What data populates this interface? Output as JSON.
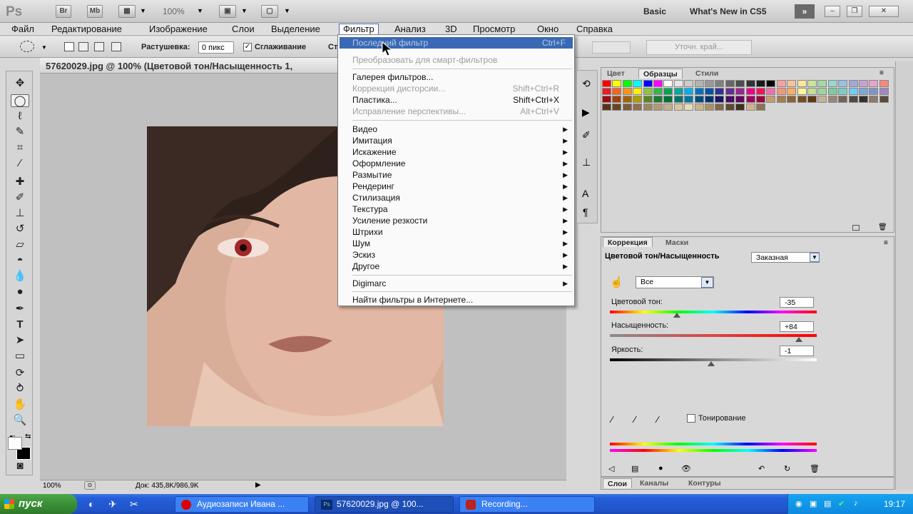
{
  "appbar": {
    "logo": "Ps",
    "bridge": "Br",
    "minibridge": "Mb",
    "zoom": "100%",
    "workspace_basic": "Basic",
    "workspace_new": "What's New in CS5"
  },
  "menubar": {
    "items": [
      "Файл",
      "Редактирование",
      "Изображение",
      "Слои",
      "Выделение",
      "Фильтр",
      "Анализ",
      "3D",
      "Просмотр",
      "Окно",
      "Справка"
    ],
    "active": "Фильтр"
  },
  "options": {
    "feather_label": "Растушевка:",
    "feather_value": "0 пикс",
    "antialias_label": "Сглаживание",
    "style_label": "Ст",
    "refine_edge": "Уточн. край..."
  },
  "document": {
    "title": "57620029.jpg @ 100% (Цветовой тон/Насыщенность 1,",
    "status_zoom": "100%",
    "status_doc": "Док: 435,8K/986,9K"
  },
  "filter_menu": {
    "last_filter": "Последний фильтр",
    "last_filter_sc": "Ctrl+F",
    "convert_smart": "Преобразовать для смарт-фильтров",
    "gallery": "Галерея фильтров...",
    "lens_correction": "Коррекция дисторсии...",
    "lens_correction_sc": "Shift+Ctrl+R",
    "liquify": "Пластика...",
    "liquify_sc": "Shift+Ctrl+X",
    "vanishing_point": "Исправление перспективы...",
    "vanishing_point_sc": "Alt+Ctrl+V",
    "submenus": [
      "Видео",
      "Имитация",
      "Искажение",
      "Оформление",
      "Размытие",
      "Рендеринг",
      "Стилизация",
      "Текстура",
      "Усиление резкости",
      "Штрихи",
      "Шум",
      "Эскиз",
      "Другое"
    ],
    "digimarc": "Digimarc",
    "browse_online": "Найти фильтры в Интернете..."
  },
  "panel_swatches": {
    "tabs": [
      "Цвет",
      "Образцы",
      "Стили"
    ],
    "selected_tab": "Образцы"
  },
  "panel_adjust": {
    "tabs": [
      "Коррекция",
      "Маски"
    ],
    "title": "Цветовой тон/Насыщенность",
    "preset": "Заказная",
    "channel": "Все",
    "hue_label": "Цветовой тон:",
    "hue_value": "-35",
    "saturation_label": "Насыщенность:",
    "saturation_value": "+84",
    "lightness_label": "Яркость:",
    "lightness_value": "-1",
    "colorize_label": "Тонирование"
  },
  "layers_tabs": [
    "Слои",
    "Каналы",
    "Контуры"
  ],
  "taskbar": {
    "start": "пуск",
    "tasks": [
      "Аудиозаписи Ивана ...",
      "57620029.jpg @ 100...",
      "Recording..."
    ],
    "clock": "19:17"
  },
  "colors": {
    "menu_highlight": "#3969b4",
    "taskbar_blue": "#245edb",
    "start_green": "#3a8f36"
  }
}
